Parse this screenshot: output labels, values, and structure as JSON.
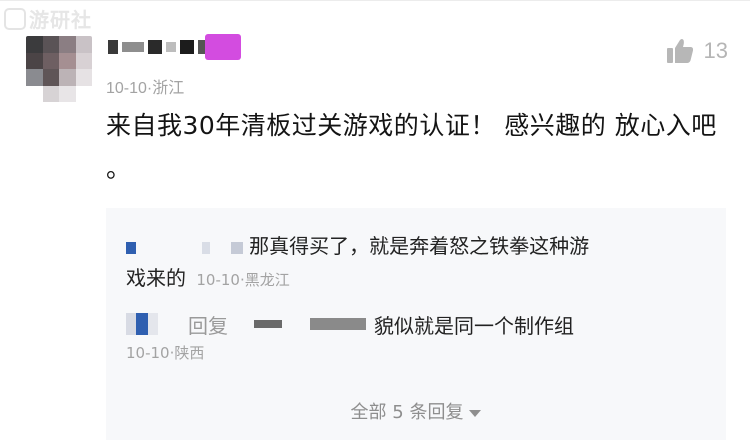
{
  "watermark": {
    "text": "游研社",
    "icon": "brand-logo-icon"
  },
  "comment": {
    "meta": "10-10·浙江",
    "text": "来自我30年清板过关游戏的认证！ 感兴趣的 放心入吧 。",
    "likes": "13",
    "like_icon": "thumbs-up-icon",
    "badge_color": "#d34ce0"
  },
  "replies": {
    "reply1": {
      "text_line1": "那真得买了，就是奔着怒之铁拳这种游",
      "text_line2": "戏来的",
      "meta": "10-10·黑龙江"
    },
    "reply2": {
      "label": "回复",
      "text": "貌似就是同一个制作组",
      "meta": "10-10·陕西"
    },
    "all_replies_label": "全部 5 条回复",
    "all_replies_icon": "caret-down-icon"
  }
}
